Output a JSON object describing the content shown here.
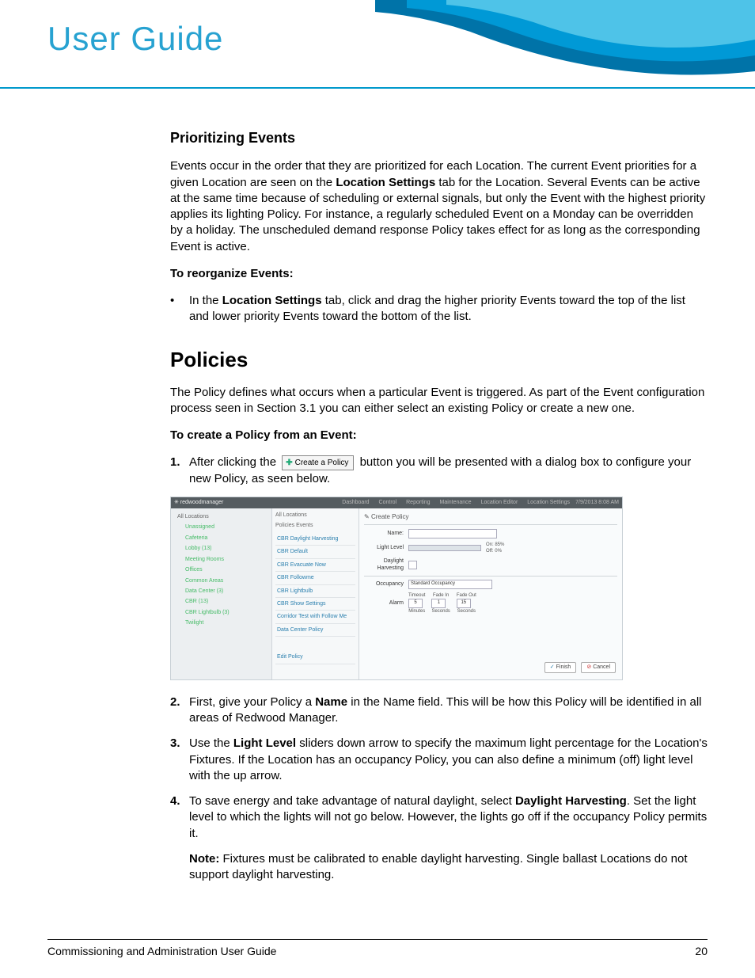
{
  "header": {
    "title": "User Guide"
  },
  "section1": {
    "heading": "Prioritizing Events",
    "para1_a": "Events occur in the order that they are prioritized for each Location. The current Event priorities for a given Location are seen on the ",
    "para1_b": "Location Settings",
    "para1_c": " tab for the Location. Several Events can be active at the same time because of scheduling or external signals, but only the Event with the highest priority applies its lighting Policy. For instance, a regularly scheduled Event on a Monday can be overridden by a holiday. The unscheduled demand response Policy takes effect for as long as the corresponding Event is active.",
    "sub1": "To reorganize Events:",
    "bullet_a": "In the ",
    "bullet_b": "Location Settings",
    "bullet_c": " tab, click and drag the higher priority Events toward the top of the list and lower priority Events toward the bottom of the list."
  },
  "section2": {
    "heading": "Policies",
    "para1": "The Policy defines what occurs when a particular Event is triggered. As part of the Event configuration process seen in Section 3.1 you can either select an existing Policy or create a new one.",
    "sub1": "To create a Policy from an Event:",
    "step1_a": "After clicking the ",
    "step1_btn": "Create a Policy",
    "step1_b": " button you will be presented with a dialog box to configure your new Policy, as seen below.",
    "step2_a": "First, give your Policy a ",
    "step2_b": "Name",
    "step2_c": " in the Name field.    This will be how this Policy will be identified in all areas of Redwood Manager.",
    "step3_a": "Use the ",
    "step3_b": "Light Level",
    "step3_c": " sliders down arrow to specify the maximum light percentage for the Location's Fixtures. If the Location has an occupancy Policy, you can also define a minimum (off) light level with the up arrow.",
    "step4_a": "To save energy and take advantage of natural daylight, select ",
    "step4_b": "Daylight Harvesting",
    "step4_c": ". Set the light level to which the lights will not go below. However, the lights go off if the occupancy Policy permits it.",
    "note_a": "Note:",
    "note_b": " Fixtures must be calibrated to enable daylight harvesting. Single ballast Locations do not support daylight harvesting."
  },
  "screenshot": {
    "brand": "✳ redwoodmanager",
    "nav": [
      "Dashboard",
      "Control",
      "Reporting",
      "Maintenance",
      "Location Editor",
      "Location Settings"
    ],
    "topright": "7/9/2013  8:08 AM",
    "side_hdr": "All Locations",
    "side": [
      "Unassigned",
      "Cafeteria",
      "Lobby (13)",
      "Meeting Rooms",
      "Offices",
      "Common Areas",
      "Data Center (3)",
      "CBR (13)",
      "CBR Lightbulb (3)",
      "Twilight"
    ],
    "mid_top": "All Locations",
    "mid_tabs": "Policies    Events",
    "mid": [
      "CBR Daylight Harvesting",
      "CBR Default",
      "CBR Evacuate Now",
      "CBR Followme",
      "CBR Lightbulb",
      "CBR Show Settings",
      "Corridor Test with Follow Me",
      "Data Center Policy"
    ],
    "mid_edit": "Edit Policy",
    "dlg_hdr": "Create Policy",
    "f_name": "Name:",
    "f_light": "Light Level",
    "f_light_on": "On: 85%",
    "f_light_off": "Off: 0%",
    "f_dh": "Daylight Harvesting",
    "f_occ": "Occupancy",
    "f_occ_val": "Standard Occupancy",
    "f_alarm": "Alarm",
    "f_timeout": "Timeout",
    "f_fadein": "Fade In",
    "f_fadeout": "Fade Out",
    "f_t1": "5",
    "f_t2": "1",
    "f_t3": "15",
    "f_u1": "Minutes",
    "f_u2": "Seconds",
    "f_u3": "Seconds",
    "btn_finish": "Finish",
    "btn_cancel": "Cancel"
  },
  "footer": {
    "left": "Commissioning and Administration User Guide",
    "right": "20"
  }
}
